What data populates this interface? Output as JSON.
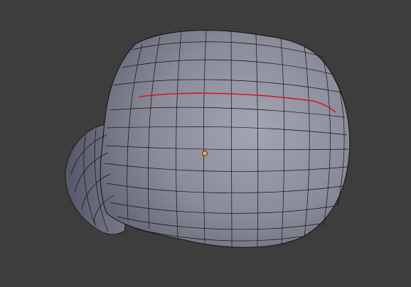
{
  "viewport": {
    "background": "#3d3d3d",
    "mesh_fill": "#8a8b98",
    "mesh_highlight": "#a4a5b3",
    "mesh_shadow": "#5f6070",
    "wire_color": "#111111",
    "selected_edge_color": "#d21a1a",
    "origin_color": "#f2a33a",
    "mode": "Edit Mode",
    "display": "wireframe-over-solid"
  }
}
